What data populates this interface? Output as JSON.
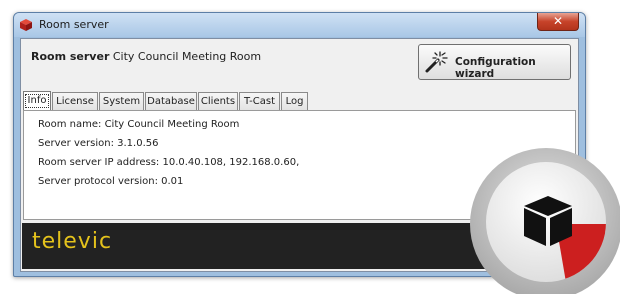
{
  "window": {
    "title": "Room server",
    "close_glyph": "✕"
  },
  "header": {
    "label_bold": "Room server",
    "room": "City Council Meeting Room"
  },
  "wizard": {
    "label": "Configuration wizard",
    "icon": "magic-wand-icon"
  },
  "tabs": [
    {
      "label": "Info",
      "active": true
    },
    {
      "label": "License"
    },
    {
      "label": "System"
    },
    {
      "label": "Database"
    },
    {
      "label": "Clients"
    },
    {
      "label": "T-Cast"
    },
    {
      "label": "Log"
    }
  ],
  "info": {
    "room_name": "Room name: City Council Meeting Room",
    "server_version": "Server version: 3.1.0.56",
    "ip_address": "Room server IP address: 10.0.40.108, 192.168.0.60,",
    "protocol_version": "Server protocol version:  0.01"
  },
  "footer": {
    "brand": "televic",
    "brand_color": "#e4c21c"
  },
  "colors": {
    "accent_red": "#cc1f1f",
    "footer_bg": "#222222"
  }
}
